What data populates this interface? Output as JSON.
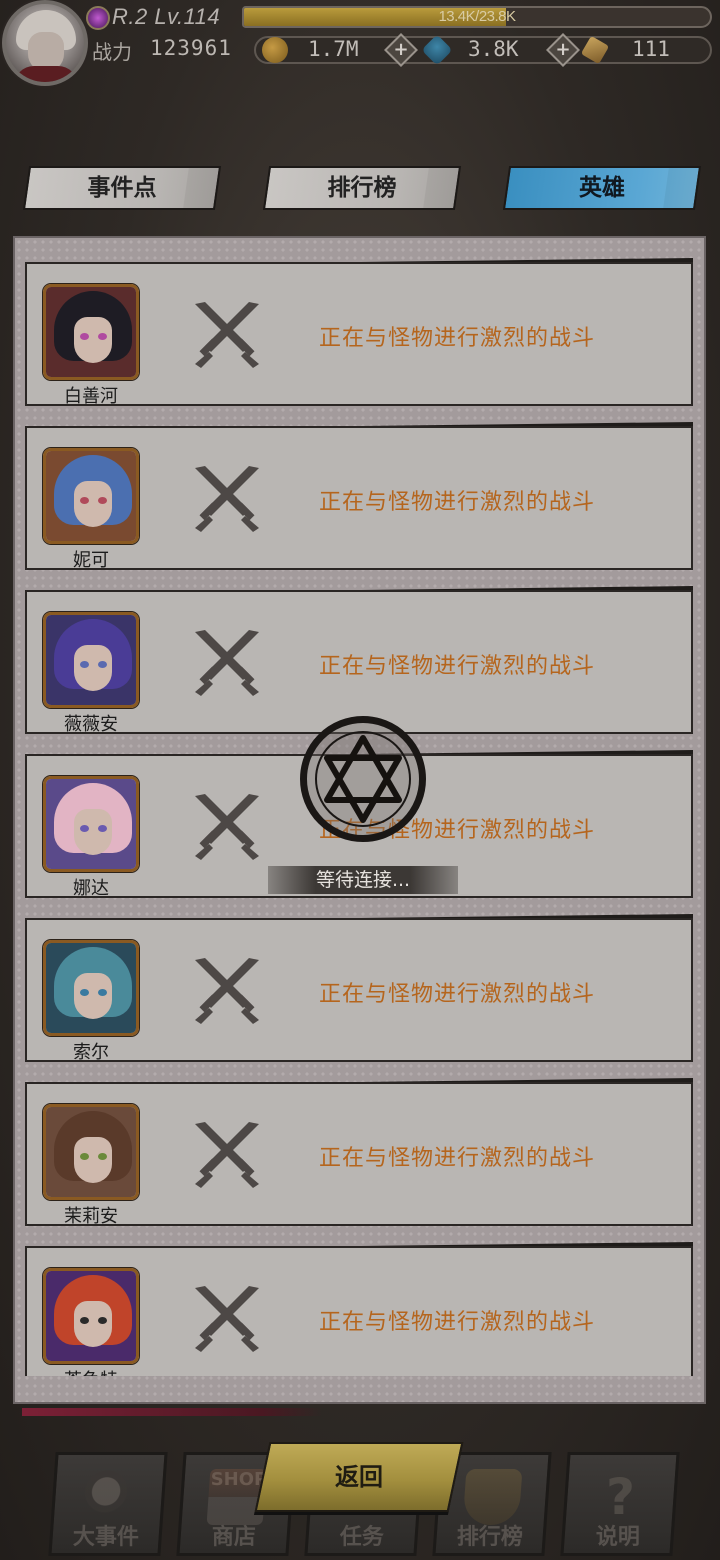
{
  "header": {
    "rank_level": "R.2 Lv.114",
    "exp_text": "13.4K/23.8K",
    "exp_progress": 0.563,
    "power_label": "战力",
    "power_value": "123961",
    "resources": {
      "gold": "1.7M",
      "gems": "3.8K",
      "scrolls": "111"
    }
  },
  "tabs": [
    {
      "label": "事件点",
      "active": false
    },
    {
      "label": "排行榜",
      "active": false
    },
    {
      "label": "英雄",
      "active": true
    }
  ],
  "heroes": [
    {
      "name": "白善河",
      "status": "正在与怪物进行激烈的战斗"
    },
    {
      "name": "妮可",
      "status": "正在与怪物进行激烈的战斗"
    },
    {
      "name": "薇薇安",
      "status": "正在与怪物进行激烈的战斗"
    },
    {
      "name": "娜达",
      "status": "正在与怪物进行激烈的战斗"
    },
    {
      "name": "索尔",
      "status": "正在与怪物进行激烈的战斗"
    },
    {
      "name": "茉莉安",
      "status": "正在与怪物进行激烈的战斗"
    },
    {
      "name": "茶鱼特",
      "status": "正在与怪物进行激烈的战斗"
    }
  ],
  "loading": {
    "text": "等待连接..."
  },
  "bottom_nav": {
    "items": [
      "大事件",
      "商店",
      "任务",
      "排行榜",
      "说明"
    ],
    "shop_sign": "SHOP",
    "back_label": "返回"
  },
  "colors": {
    "status_text": "#b5651d",
    "active_tab": "#4a9bc8",
    "back_button": "#b09a48"
  }
}
